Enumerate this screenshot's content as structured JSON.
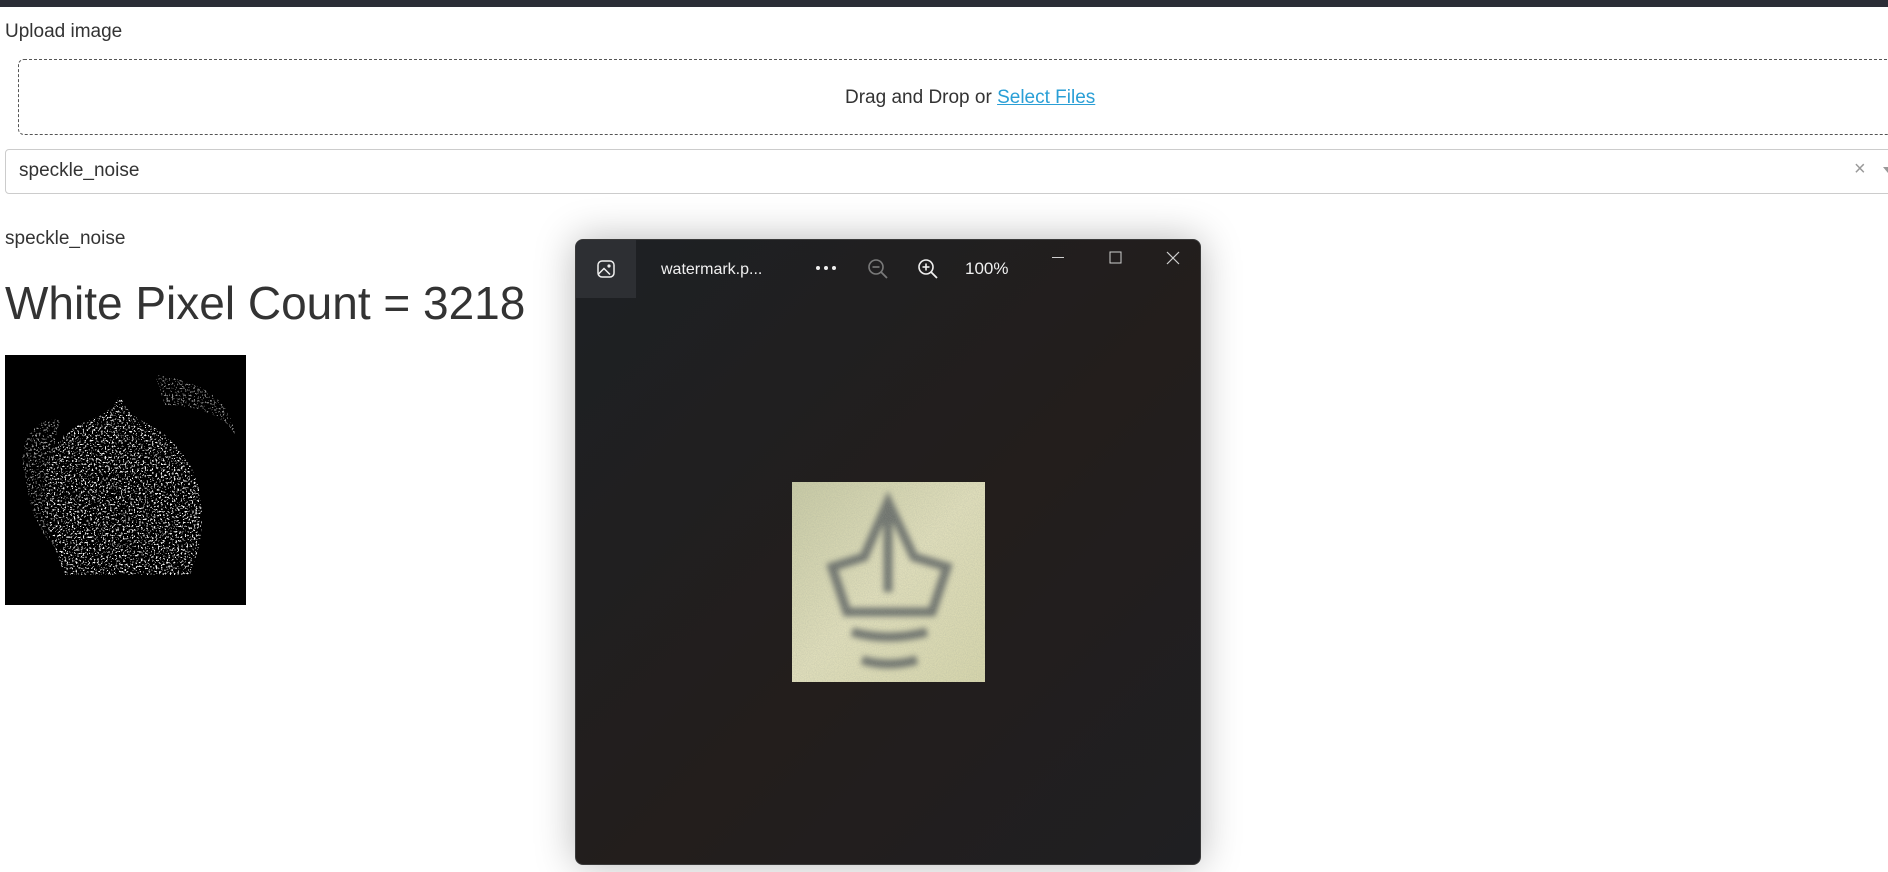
{
  "upload": {
    "label": "Upload image",
    "drop_text": "Drag and Drop or ",
    "select_link": "Select Files"
  },
  "method_select": {
    "value": "speckle_noise",
    "clear_symbol": "×"
  },
  "result": {
    "method_label": "speckle_noise",
    "heading": "White Pixel Count = 3218"
  },
  "viewer": {
    "title": "watermark.p...",
    "zoom": "100%",
    "icons": [
      "gallery-icon",
      "more-icon",
      "zoom-out-icon",
      "zoom-in-icon",
      "minimize-icon",
      "maximize-icon",
      "close-icon"
    ]
  },
  "colors": {
    "link": "#2a9fd6",
    "topbar": "#2b2d36",
    "viewer_bg": "#201f21"
  }
}
